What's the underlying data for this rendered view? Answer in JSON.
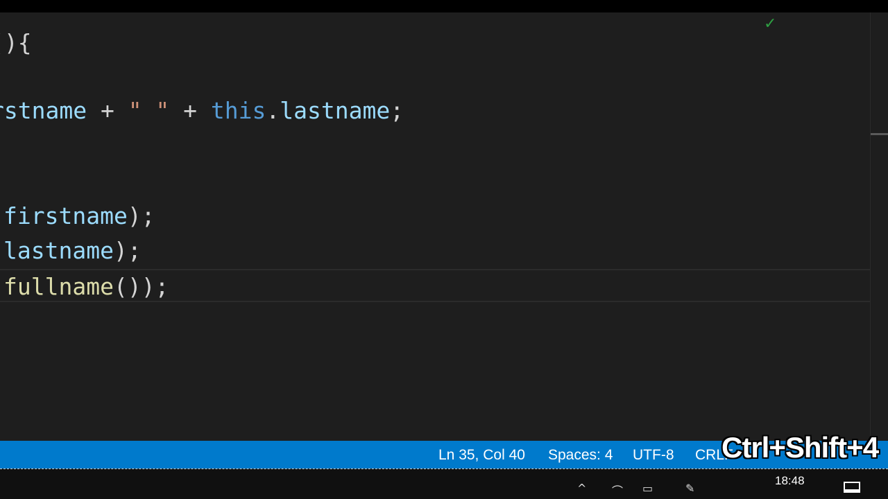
{
  "editor": {
    "lines": [
      {
        "tokens": [
          {
            "text": "(){",
            "cls": "tok-punct"
          }
        ]
      },
      {
        "tokens": [
          {
            "text": "rstname",
            "cls": "tok-var"
          },
          {
            "text": " + ",
            "cls": "tok-punct"
          },
          {
            "text": "\" \"",
            "cls": "tok-str"
          },
          {
            "text": " + ",
            "cls": "tok-punct"
          },
          {
            "text": "this",
            "cls": "tok-kw"
          },
          {
            "text": ".",
            "cls": "tok-punct"
          },
          {
            "text": "lastname",
            "cls": "tok-var"
          },
          {
            "text": ";",
            "cls": "tok-punct"
          }
        ]
      },
      {
        "tokens": [
          {
            "text": "firstname",
            "cls": "tok-var"
          },
          {
            "text": ");",
            "cls": "tok-punct"
          }
        ]
      },
      {
        "tokens": [
          {
            "text": "lastname",
            "cls": "tok-var"
          },
          {
            "text": ");",
            "cls": "tok-punct"
          }
        ]
      },
      {
        "tokens": [
          {
            "text": "fullname",
            "cls": "tok-fn"
          },
          {
            "text": "());",
            "cls": "tok-punct"
          }
        ]
      }
    ],
    "check_icon": "✓"
  },
  "statusbar": {
    "cursor_position": "Ln 35, Col 40",
    "indentation": "Spaces: 4",
    "encoding": "UTF-8",
    "line_ending": "CRLF"
  },
  "overlay": {
    "shortcut": "Ctrl+Shift+4"
  },
  "taskbar": {
    "clock": "18:48",
    "tray_icons": [
      "chevron-up-icon",
      "network-icon",
      "battery-icon",
      "pen-icon"
    ],
    "tray_glyphs": [
      "^",
      "⌒",
      "▭",
      "✎"
    ]
  },
  "colors": {
    "statusbar_bg": "#007acc",
    "editor_bg": "#1e1e1e",
    "variable": "#9cdcfe",
    "keyword": "#569cd6",
    "string": "#ce9178",
    "function": "#dcdcaa"
  }
}
